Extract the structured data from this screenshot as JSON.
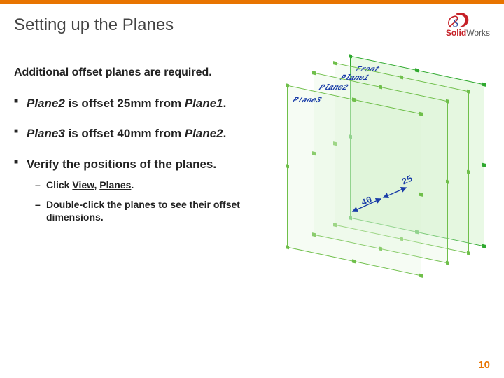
{
  "header": {
    "title": "Setting up the Planes",
    "brand_solid": "Solid",
    "brand_works": "Works"
  },
  "intro": "Additional offset planes are required.",
  "bullets": {
    "b1": {
      "p2": "Plane2",
      "mid": " is offset 25mm from ",
      "p1": "Plane1",
      "dot": "."
    },
    "b2": {
      "p3": "Plane3",
      "mid": " is offset 40mm from ",
      "p2": "Plane2",
      "dot": "."
    },
    "b3": {
      "text": "Verify the positions of the planes.",
      "s1_a": "Click ",
      "s1_view": "View",
      "s1_comma": ", ",
      "s1_planes": "Planes",
      "s1_dot": ".",
      "s2": "Double-click the planes to see their offset dimensions."
    }
  },
  "figure": {
    "labels": {
      "front": "Front",
      "p1": "Plane1",
      "p2": "Plane2",
      "p3": "Plane3"
    },
    "dims": {
      "d25": "25",
      "d40": "40"
    }
  },
  "page": "10"
}
